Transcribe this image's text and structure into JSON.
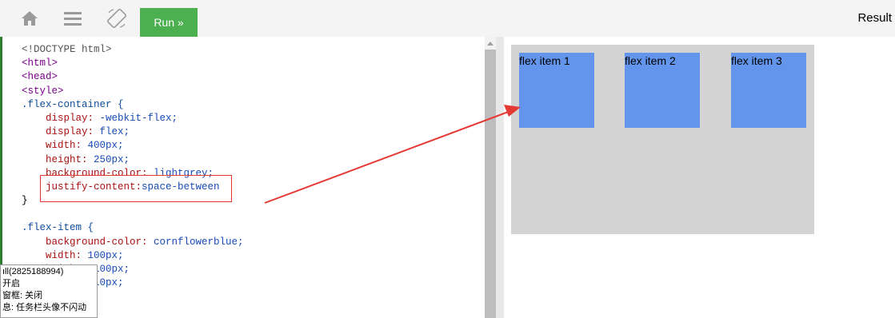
{
  "toolbar": {
    "home_icon": "home-icon",
    "menu_icon": "menu-icon",
    "rotate_icon": "rotate-icon",
    "run_label": "Run »",
    "result_label": "Result"
  },
  "code_lines": [
    "<!DOCTYPE html>",
    "<html>",
    "<head>",
    "<style>",
    ".flex-container {",
    "    display: -webkit-flex;",
    "    display: flex;",
    "    width: 400px;",
    "    height: 250px;",
    "    background-color: lightgrey;",
    "    justify-content:space-between",
    "}",
    "",
    ".flex-item {",
    "    background-color: cornflowerblue;",
    "    width: 100px;",
    "    height: 100px;",
    "    margin: 10px;"
  ],
  "result": {
    "items": [
      "flex item 1",
      "flex item 2",
      "flex item 3"
    ],
    "container_color": "#d3d3d3",
    "item_color": "#6495ed"
  },
  "tooltip": {
    "lines": [
      "ıll(2825188994)",
      "开启",
      "窗框: 关闭",
      "息: 任务栏头像不闪动"
    ]
  },
  "colors": {
    "run_button": "#4caf50",
    "annotation": "#e53935"
  }
}
